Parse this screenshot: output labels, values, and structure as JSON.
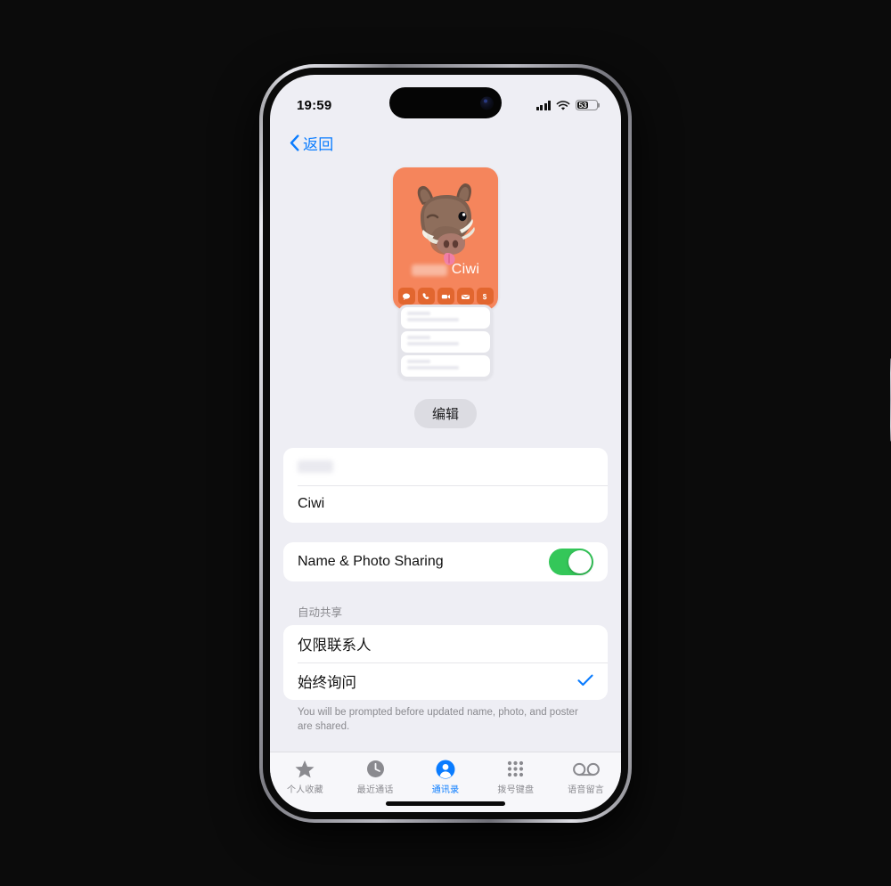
{
  "status_bar": {
    "time": "19:59",
    "cellular_icon": "cellular-bars-icon",
    "wifi_icon": "wifi-icon",
    "battery_percent": "53",
    "battery_icon": "battery-icon"
  },
  "nav": {
    "back_label": "返回",
    "back_icon": "chevron-left-icon"
  },
  "poster": {
    "background_color": "#f5855c",
    "avatar_icon": "boar-memoji-avatar",
    "name_visible": "Ciwi",
    "name_redacted": true,
    "actions": [
      {
        "name": "message-action",
        "icon": "message-bubble-icon"
      },
      {
        "name": "call-action",
        "icon": "phone-icon"
      },
      {
        "name": "video-action",
        "icon": "video-camera-icon"
      },
      {
        "name": "mail-action",
        "icon": "mail-envelope-icon"
      },
      {
        "name": "pay-action",
        "icon": "dollar-sign-icon"
      }
    ],
    "preview_rows": 3
  },
  "edit": {
    "label": "编辑"
  },
  "name_fields": {
    "first_name_value": "",
    "first_name_redacted": true,
    "last_name_value": "Ciwi"
  },
  "sharing": {
    "toggle_label": "Name & Photo Sharing",
    "toggle_on": true,
    "toggle_color": "#34c759"
  },
  "auto_share": {
    "section_title": "自动共享",
    "options": [
      {
        "label": "仅限联系人",
        "selected": false
      },
      {
        "label": "始终询问",
        "selected": true
      }
    ],
    "checkmark_icon": "checkmark-icon",
    "checkmark_color": "#0a7cff",
    "footnote": "You will be prompted before updated name, photo, and poster are shared."
  },
  "tabbar": {
    "active_index": 2,
    "active_color": "#0a7cff",
    "items": [
      {
        "label": "个人收藏",
        "icon": "star-icon"
      },
      {
        "label": "最近通话",
        "icon": "clock-icon"
      },
      {
        "label": "通讯录",
        "icon": "person-circle-icon"
      },
      {
        "label": "拨号键盘",
        "icon": "keypad-dots-icon"
      },
      {
        "label": "语音留言",
        "icon": "voicemail-icon"
      }
    ]
  }
}
